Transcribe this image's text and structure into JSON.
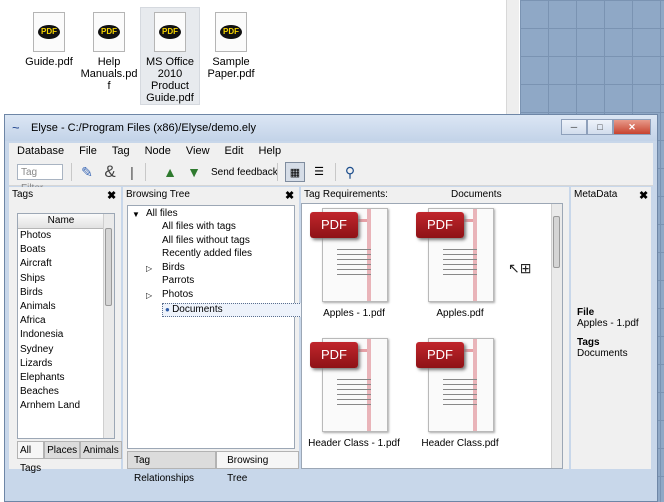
{
  "explorer": {
    "files": [
      {
        "name": "Guide.pdf",
        "icon": "pdf-file-icon",
        "selected": false
      },
      {
        "name": "Help Manuals.pdf",
        "icon": "pdf-file-icon",
        "selected": false
      },
      {
        "name": "MS Office 2010 Product Guide.pdf",
        "icon": "pdf-file-icon",
        "selected": true
      },
      {
        "name": "Sample Paper.pdf",
        "icon": "pdf-file-icon",
        "selected": false
      }
    ],
    "file_lines": [
      [
        "Guide.pdf"
      ],
      [
        "Help",
        "Manuals.pd",
        "f"
      ],
      [
        "MS Office",
        "2010",
        "Product",
        "Guide.pdf"
      ],
      [
        "Sample",
        "Paper.pdf"
      ]
    ],
    "pdf_badge": "PDF"
  },
  "window": {
    "title": "Elyse - C:/Program Files (x86)/Elyse/demo.ely",
    "logo_glyph": "~",
    "minimize_glyph": "─",
    "maximize_glyph": "□",
    "close_glyph": "✕"
  },
  "menu": [
    "Database",
    "File",
    "Tag",
    "Node",
    "View",
    "Edit",
    "Help"
  ],
  "toolbar": {
    "tag_filter_placeholder": "Tag Filter",
    "send_feedback": "Send feedback"
  },
  "tags_panel": {
    "title": "Tags",
    "column": "Name",
    "items": [
      "Photos",
      "Boats",
      "Aircraft",
      "Ships",
      "Birds",
      "Animals",
      "Africa",
      "Indonesia",
      "Sydney",
      "Lizards",
      "Elephants",
      "Beaches",
      "Arnhem Land"
    ],
    "tabs": [
      "All Tags",
      "Places",
      "Animals"
    ],
    "active_tab": "All Tags"
  },
  "browsing_tree": {
    "title": "Browsing Tree",
    "items": [
      {
        "label": "All files",
        "level": 0,
        "expander": "▼"
      },
      {
        "label": "All files with tags",
        "level": 1,
        "expander": ""
      },
      {
        "label": "All files without tags",
        "level": 1,
        "expander": ""
      },
      {
        "label": "Recently added files",
        "level": 1,
        "expander": ""
      },
      {
        "label": "Birds",
        "level": 1,
        "expander": "▷"
      },
      {
        "label": "Parrots",
        "level": 1,
        "expander": ""
      },
      {
        "label": "Photos",
        "level": 1,
        "expander": "▷"
      },
      {
        "label": "Documents",
        "level": 2,
        "expander": "",
        "selected": true
      }
    ],
    "tabs": [
      "Tag Relationships",
      "Browsing Tree"
    ],
    "active_tab": "Browsing Tree"
  },
  "documents_panel": {
    "tag_requirements_label": "Tag Requirements:",
    "title": "Documents",
    "files": [
      "Apples - 1.pdf",
      "Apples.pdf",
      "Header Class - 1.pdf",
      "Header Class.pdf"
    ],
    "badge": "PDF"
  },
  "metadata": {
    "title": "MetaData",
    "file_label": "File",
    "file_value": "Apples - 1.pdf",
    "tags_label": "Tags",
    "tags_value": "Documents"
  },
  "close_glyph": "✖"
}
